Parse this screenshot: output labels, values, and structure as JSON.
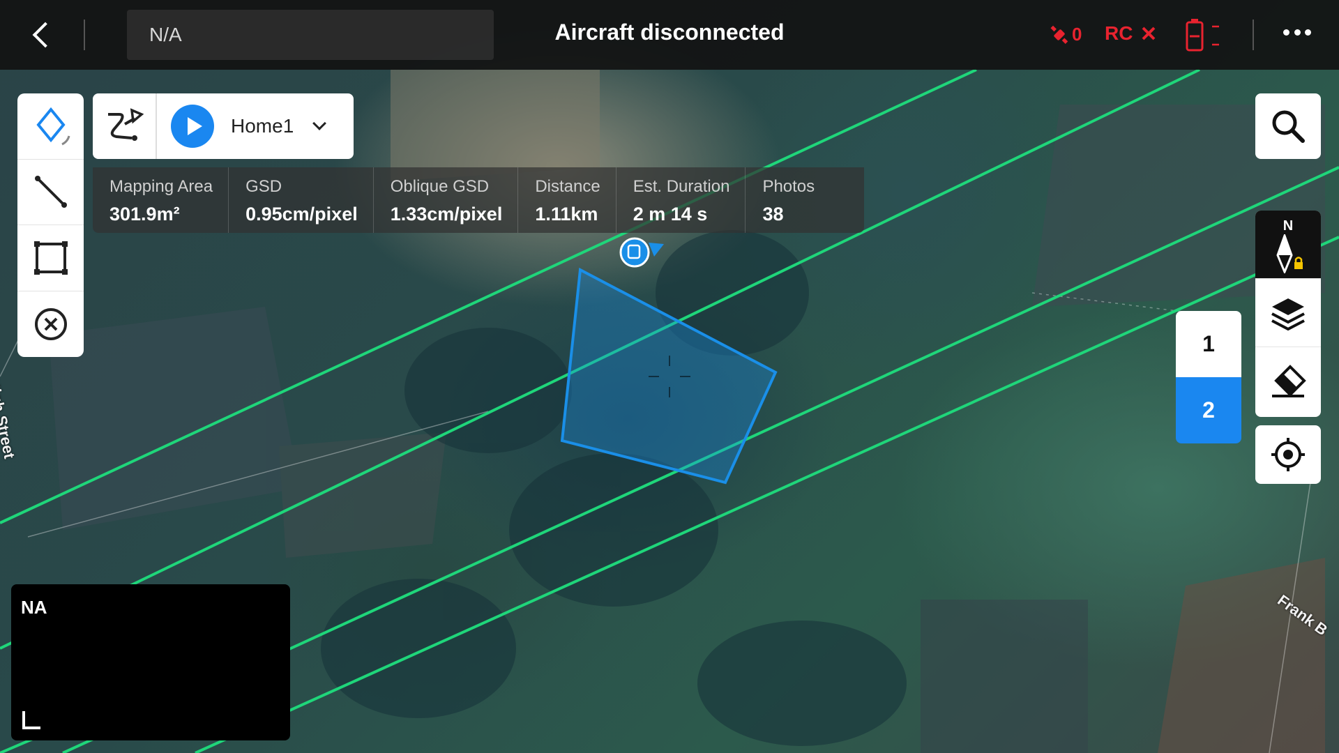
{
  "header": {
    "back_icon": "chevron-left-icon",
    "mission_name": "N/A",
    "status": "Aircraft disconnected",
    "satellite_count": "0",
    "rc_label": "RC",
    "rc_state_icon": "x-icon",
    "battery_icon": "battery-icon",
    "more_icon": "more-dots-icon"
  },
  "tools": [
    {
      "name": "polygon-area-tool",
      "icon": "diamond-icon"
    },
    {
      "name": "line-tool",
      "icon": "line-segment-icon"
    },
    {
      "name": "rectangle-tool",
      "icon": "rectangle-select-icon"
    },
    {
      "name": "clear-tool",
      "icon": "clear-icon"
    }
  ],
  "route": {
    "icon": "route-icon",
    "play_icon": "play-icon",
    "name": "Home1",
    "dropdown_icon": "chevron-down-icon"
  },
  "stats": [
    {
      "label": "Mapping Area",
      "value": "301.9m²"
    },
    {
      "label": "GSD",
      "value": "0.95cm/pixel"
    },
    {
      "label": "Oblique GSD",
      "value": "1.33cm/pixel"
    },
    {
      "label": "Distance",
      "value": "1.11km"
    },
    {
      "label": "Est. Duration",
      "value": "2 m 14 s"
    },
    {
      "label": "Photos",
      "value": "38"
    }
  ],
  "right_controls": {
    "search_icon": "search-icon",
    "compass_label": "N",
    "compass_icon": "compass-lock-icon",
    "layers_icon": "layers-icon",
    "eraser_icon": "eraser-icon",
    "locate_icon": "locate-icon"
  },
  "layer_selector": {
    "options": [
      "1",
      "2"
    ],
    "selected": "2"
  },
  "mini_view": {
    "label": "NA"
  },
  "map": {
    "street_labels": [
      "High Street",
      "Frank B"
    ],
    "route_line_color": "#1fd67a",
    "area_color": "#1a8fe8"
  },
  "colors": {
    "accent": "#1a87f0",
    "alert": "#e8232f"
  }
}
